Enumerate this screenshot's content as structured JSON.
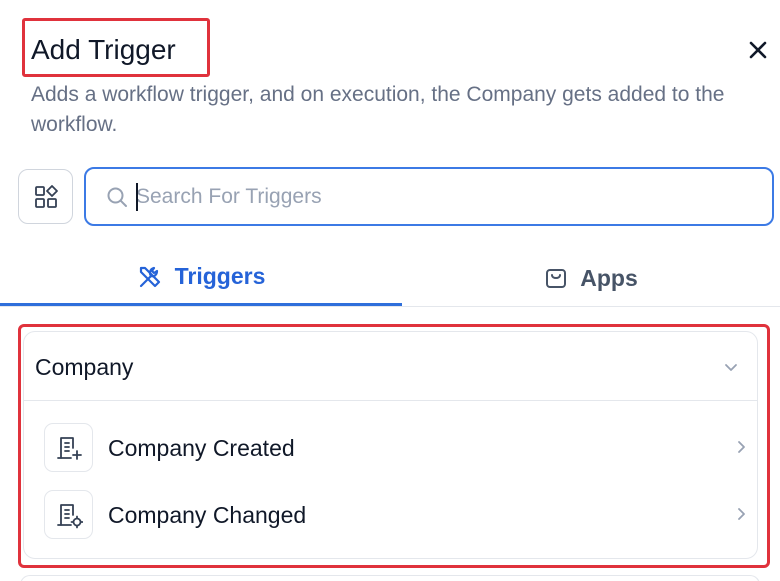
{
  "header": {
    "title": "Add Trigger",
    "description": "Adds a workflow trigger, and on execution, the Company gets added to the workflow."
  },
  "search": {
    "placeholder": "Search For Triggers",
    "value": ""
  },
  "tabs": [
    {
      "label": "Triggers",
      "icon": "tools-icon",
      "active": true
    },
    {
      "label": "Apps",
      "icon": "bag-icon",
      "active": false
    }
  ],
  "group": {
    "title": "Company",
    "expanded": true,
    "items": [
      {
        "label": "Company Created",
        "icon": "building-add-icon"
      },
      {
        "label": "Company Changed",
        "icon": "building-edit-icon"
      }
    ]
  },
  "colors": {
    "accent": "#2f6fdb",
    "highlight": "#e0323c",
    "muted": "#667085"
  }
}
